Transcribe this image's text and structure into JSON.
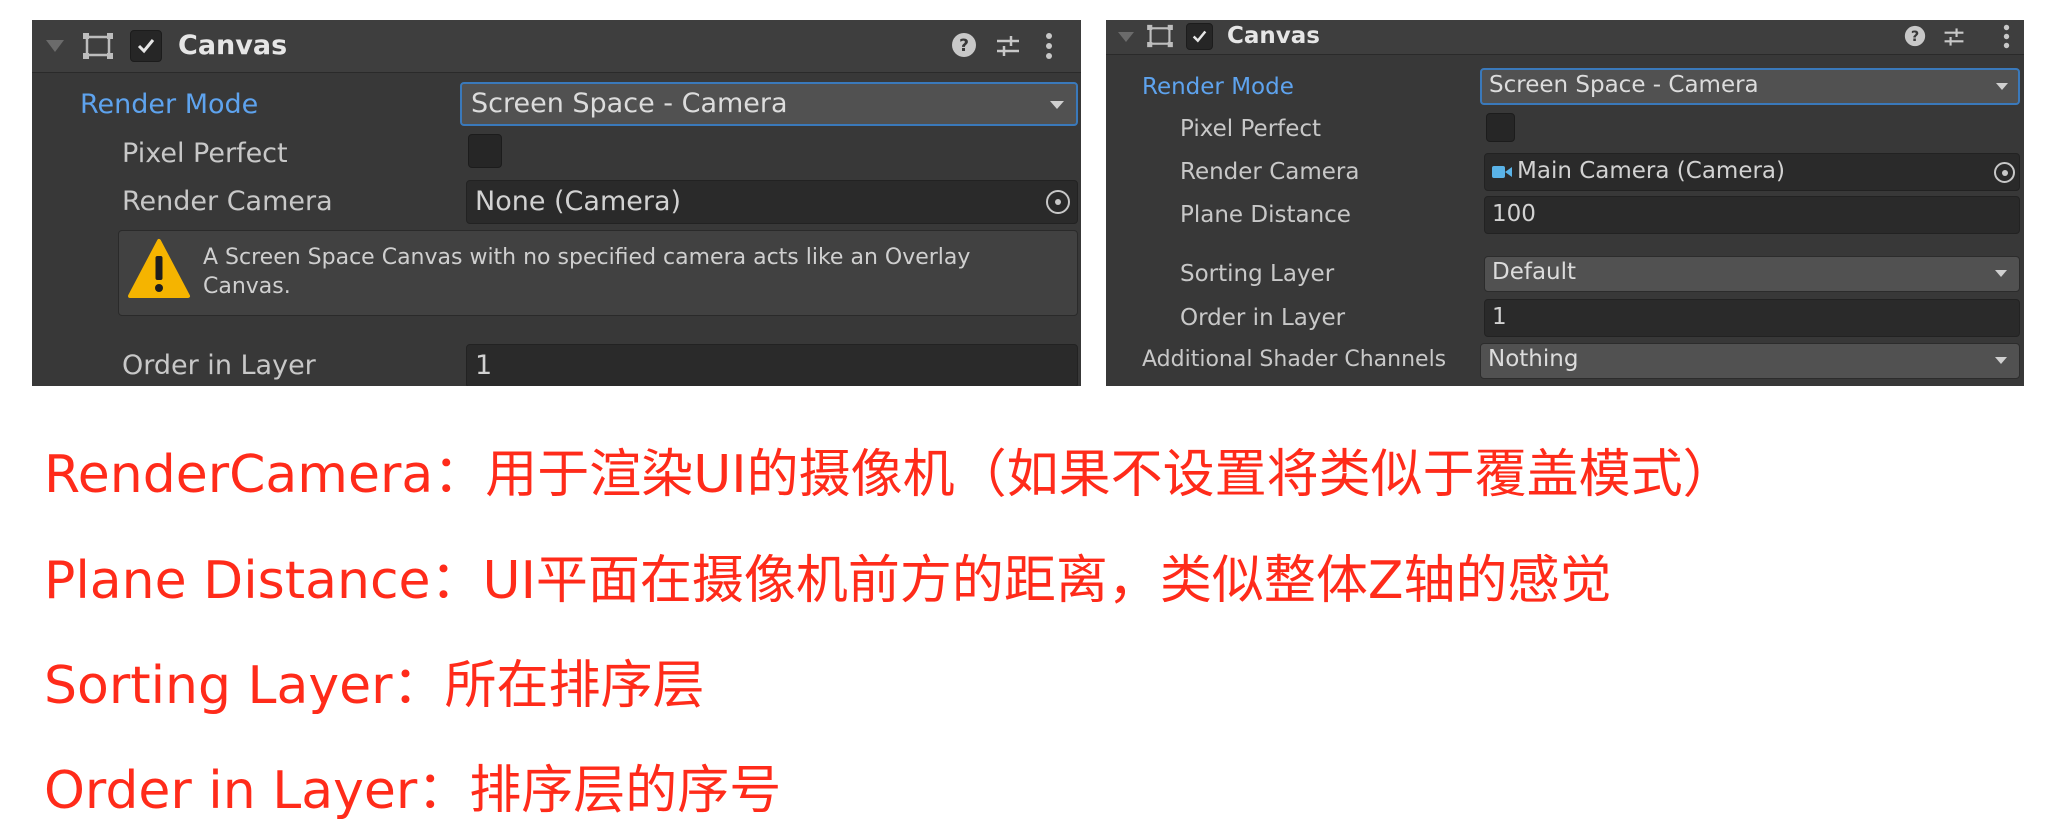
{
  "left_panel": {
    "title": "Canvas",
    "render_mode": {
      "label": "Render Mode",
      "value": "Screen Space - Camera"
    },
    "pixel_perfect": {
      "label": "Pixel Perfect",
      "checked": false
    },
    "render_camera": {
      "label": "Render Camera",
      "value": "None (Camera)"
    },
    "warning": "A Screen Space Canvas with no specified camera acts like an Overlay Canvas.",
    "order_in_layer": {
      "label": "Order in Layer",
      "value": "1"
    }
  },
  "right_panel": {
    "title": "Canvas",
    "render_mode": {
      "label": "Render Mode",
      "value": "Screen Space - Camera"
    },
    "pixel_perfect": {
      "label": "Pixel Perfect",
      "checked": false
    },
    "render_camera": {
      "label": "Render Camera",
      "value": "Main Camera (Camera)"
    },
    "plane_distance": {
      "label": "Plane Distance",
      "value": "100"
    },
    "sorting_layer": {
      "label": "Sorting Layer",
      "value": "Default"
    },
    "order_in_layer": {
      "label": "Order in Layer",
      "value": "1"
    },
    "additional_shader_channels": {
      "label": "Additional Shader Channels",
      "value": "Nothing"
    }
  },
  "icons": [
    "canvas-component-icon",
    "check-icon",
    "help-icon",
    "preset-icon",
    "more-menu-icon",
    "object-picker-icon",
    "warning-icon",
    "camera-icon",
    "dropdown-arrow-icon"
  ],
  "colors": {
    "panel_bg": "#383838",
    "field_bg": "#2a2a2a",
    "label_blue": "#5ea3ee",
    "focus_border": "#3a79bb",
    "warning_yellow": "#f5b400",
    "note_red": "#ff2b1a"
  },
  "notes": [
    "RenderCamera：用于渲染UI的摄像机（如果不设置将类似于覆盖模式）",
    "Plane Distance：UI平面在摄像机前方的距离，类似整体Z轴的感觉",
    "Sorting Layer：所在排序层",
    "Order in Layer：排序层的序号"
  ]
}
